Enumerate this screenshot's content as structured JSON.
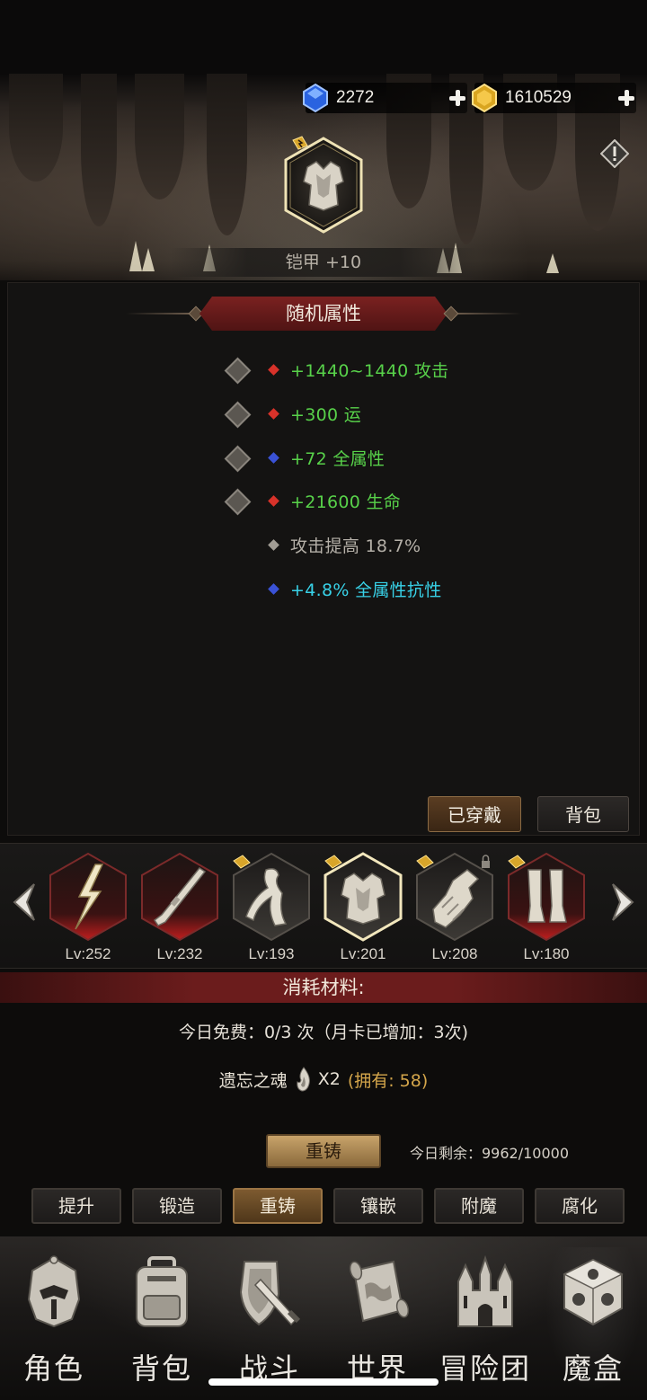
{
  "currencies": {
    "diamonds": {
      "amount": "2272",
      "icon": "blue-gem-icon"
    },
    "gold": {
      "amount": "1610529",
      "icon": "gold-gem-icon"
    }
  },
  "item": {
    "title": "铠甲 +10",
    "icon": "armor-icon"
  },
  "attributes": {
    "header": "随机属性",
    "rows": [
      {
        "text": "+1440~1440 攻击",
        "color": "#58d24a",
        "dot_color": "#d8322a",
        "locked": true
      },
      {
        "text": "+300 运",
        "color": "#58d24a",
        "dot_color": "#d8322a",
        "locked": true
      },
      {
        "text": "+72 全属性",
        "color": "#58d24a",
        "dot_color": "#3a52d6",
        "locked": true
      },
      {
        "text": "+21600 生命",
        "color": "#58d24a",
        "dot_color": "#d8322a",
        "locked": true
      },
      {
        "text": "攻击提高 18.7%",
        "color": "#b5b0a8",
        "dot_color": "#a19c94",
        "locked": false
      },
      {
        "text": "+4.8% 全属性抗性",
        "color": "#38d2e8",
        "dot_color": "#3a52d6",
        "locked": false
      }
    ]
  },
  "panel_buttons": {
    "equipped": "已穿戴",
    "backpack": "背包"
  },
  "equipment": [
    {
      "level": "Lv:252",
      "icon": "lightning-bolt-icon",
      "tier": "red",
      "rune": false
    },
    {
      "level": "Lv:232",
      "icon": "musket-icon",
      "tier": "red",
      "rune": false
    },
    {
      "level": "Lv:193",
      "icon": "scarf-icon",
      "tier": "gray",
      "rune": true
    },
    {
      "level": "Lv:201",
      "icon": "armor-icon",
      "tier": "gray",
      "rune": true,
      "selected": true
    },
    {
      "level": "Lv:208",
      "icon": "gauntlet-icon",
      "tier": "gray",
      "rune": true,
      "locked": true
    },
    {
      "level": "Lv:180",
      "icon": "greaves-icon",
      "tier": "red",
      "rune": true
    }
  ],
  "materials": {
    "header": "消耗材料:",
    "free_today": "今日免费：0/3 次（月卡已增加：3次)",
    "soul_name": "遗忘之魂",
    "soul_icon": "soul-flame-icon",
    "soul_qty": "X2",
    "soul_owned": "(拥有: 58)"
  },
  "reforge": {
    "button": "重铸",
    "remaining": "今日剩余：9962/10000"
  },
  "subtabs": [
    "提升",
    "锻造",
    "重铸",
    "镶嵌",
    "附魔",
    "腐化"
  ],
  "subtab_active": "重铸",
  "nav": [
    {
      "label": "角色",
      "icon": "helmet-icon"
    },
    {
      "label": "背包",
      "icon": "backpack-icon"
    },
    {
      "label": "战斗",
      "icon": "shield-sword-icon"
    },
    {
      "label": "世界",
      "icon": "map-scroll-icon"
    },
    {
      "label": "冒险团",
      "icon": "castle-icon"
    },
    {
      "label": "魔盒",
      "icon": "magic-cube-icon",
      "active": true
    }
  ],
  "colors": {
    "accent_red": "#6b1c1c",
    "active_tab": "#7d5a30",
    "owned_orange": "#d4a64b"
  }
}
